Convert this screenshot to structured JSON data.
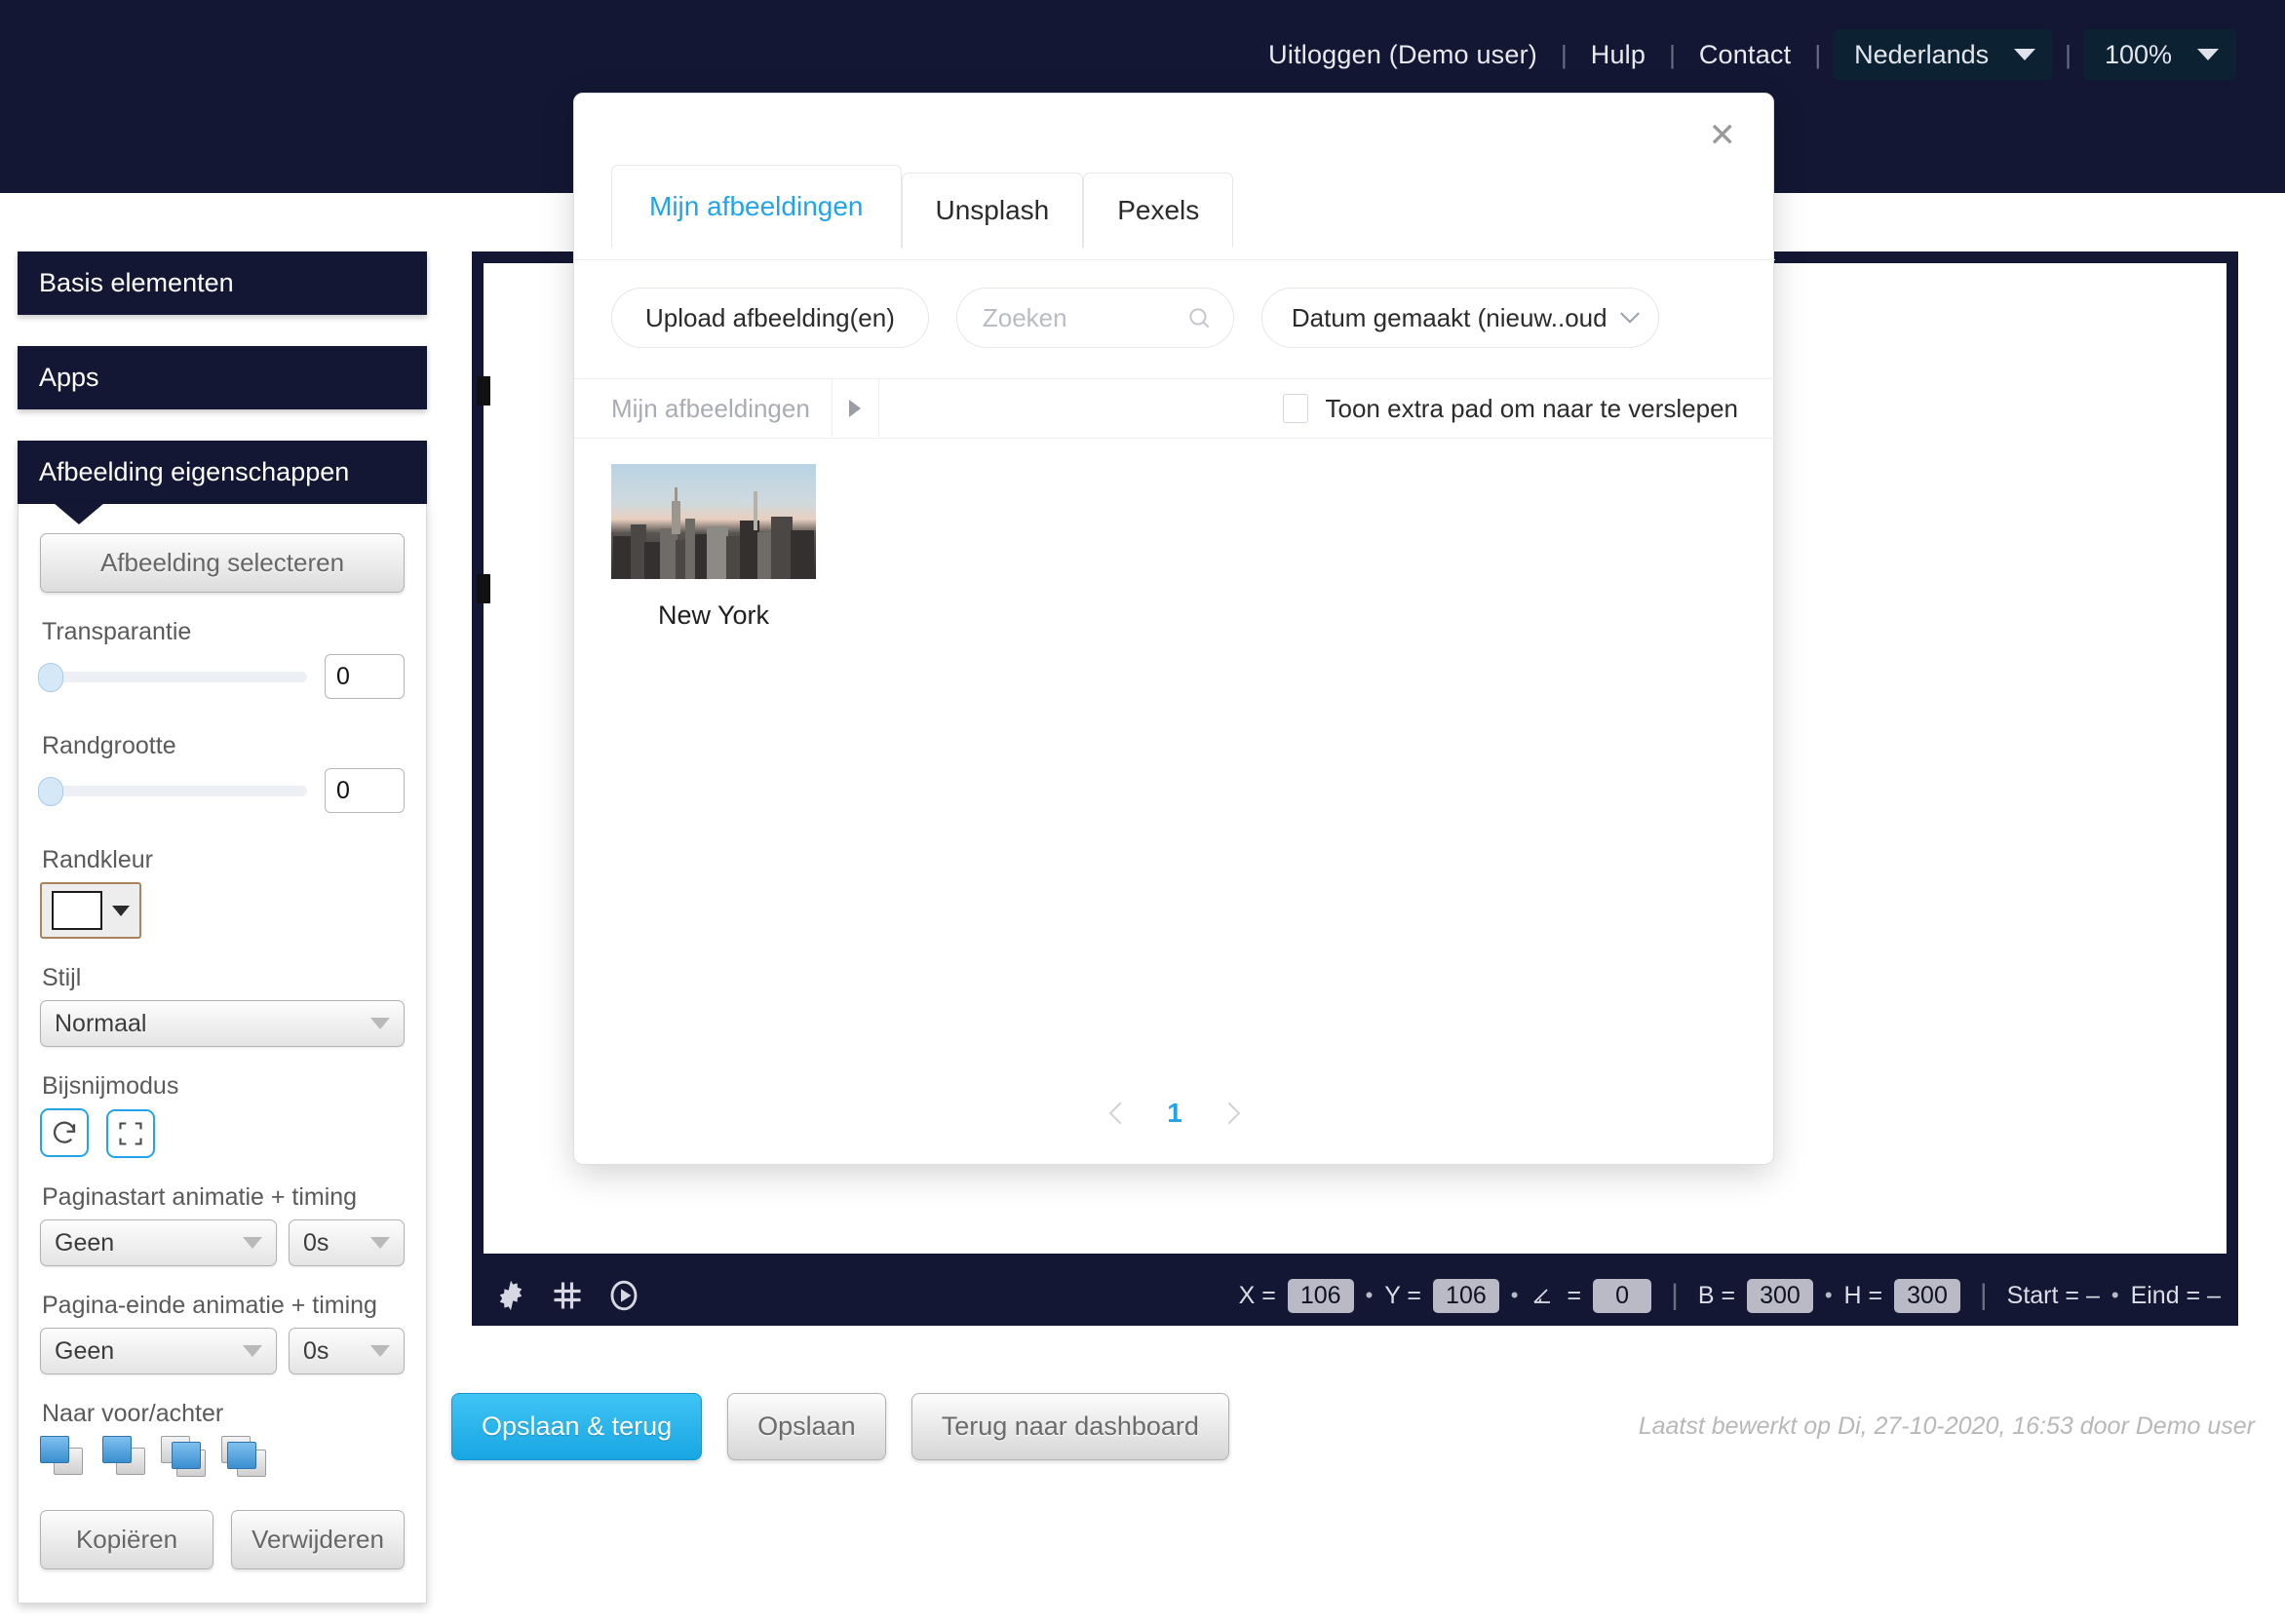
{
  "topbar": {
    "logout": "Uitloggen (Demo user)",
    "help": "Hulp",
    "contact": "Contact",
    "separator": "|",
    "language": "Nederlands",
    "zoom": "100%"
  },
  "sidebar": {
    "panels": [
      {
        "title": "Basis elementen"
      },
      {
        "title": "Apps"
      },
      {
        "title": "Afbeelding eigenschappen"
      }
    ],
    "select_image_button": "Afbeelding selecteren",
    "fields": {
      "transparency_label": "Transparantie",
      "transparency_value": "0",
      "border_size_label": "Randgrootte",
      "border_size_value": "0",
      "border_color_label": "Randkleur",
      "style_label": "Stijl",
      "style_value": "Normaal",
      "crop_mode_label": "Bijsnijmodus",
      "page_start_anim_label": "Paginastart animatie + timing",
      "page_start_anim_value": "Geen",
      "page_start_anim_time": "0s",
      "page_end_anim_label": "Pagina-einde animatie + timing",
      "page_end_anim_value": "Geen",
      "page_end_anim_time": "0s",
      "layer_label": "Naar voor/achter"
    },
    "copy_button": "Kopiëren",
    "delete_button": "Verwijderen"
  },
  "statusbar": {
    "x_label": "X =",
    "x_value": "106",
    "y_label": "Y =",
    "y_value": "106",
    "angle_value": "0",
    "w_label": "B =",
    "w_value": "300",
    "h_label": "H =",
    "h_value": "300",
    "start_text": "Start = –",
    "end_text": "Eind = –",
    "dot": "•",
    "pipe": "|",
    "angle_equals": "="
  },
  "bottom": {
    "save_back": "Opslaan & terug",
    "save": "Opslaan",
    "dashboard": "Terug naar dashboard",
    "last_edited": "Laatst bewerkt op Di, 27-10-2020, 16:53 door Demo user"
  },
  "modal": {
    "close": "✕",
    "tabs": [
      {
        "label": "Mijn afbeeldingen",
        "active": true
      },
      {
        "label": "Unsplash",
        "active": false
      },
      {
        "label": "Pexels",
        "active": false
      }
    ],
    "upload_button": "Upload afbeelding(en)",
    "search_placeholder": "Zoeken",
    "sort_value": "Datum gemaakt (nieuw..oud",
    "breadcrumb": "Mijn afbeeldingen",
    "drag_label": "Toon extra pad om naar te verslepen",
    "items": [
      {
        "label": "New York"
      }
    ],
    "pagination": {
      "current": "1"
    }
  },
  "colors": {
    "navy": "#141733",
    "accent": "#23a4e8",
    "panel_border": "#d8d8d8"
  }
}
